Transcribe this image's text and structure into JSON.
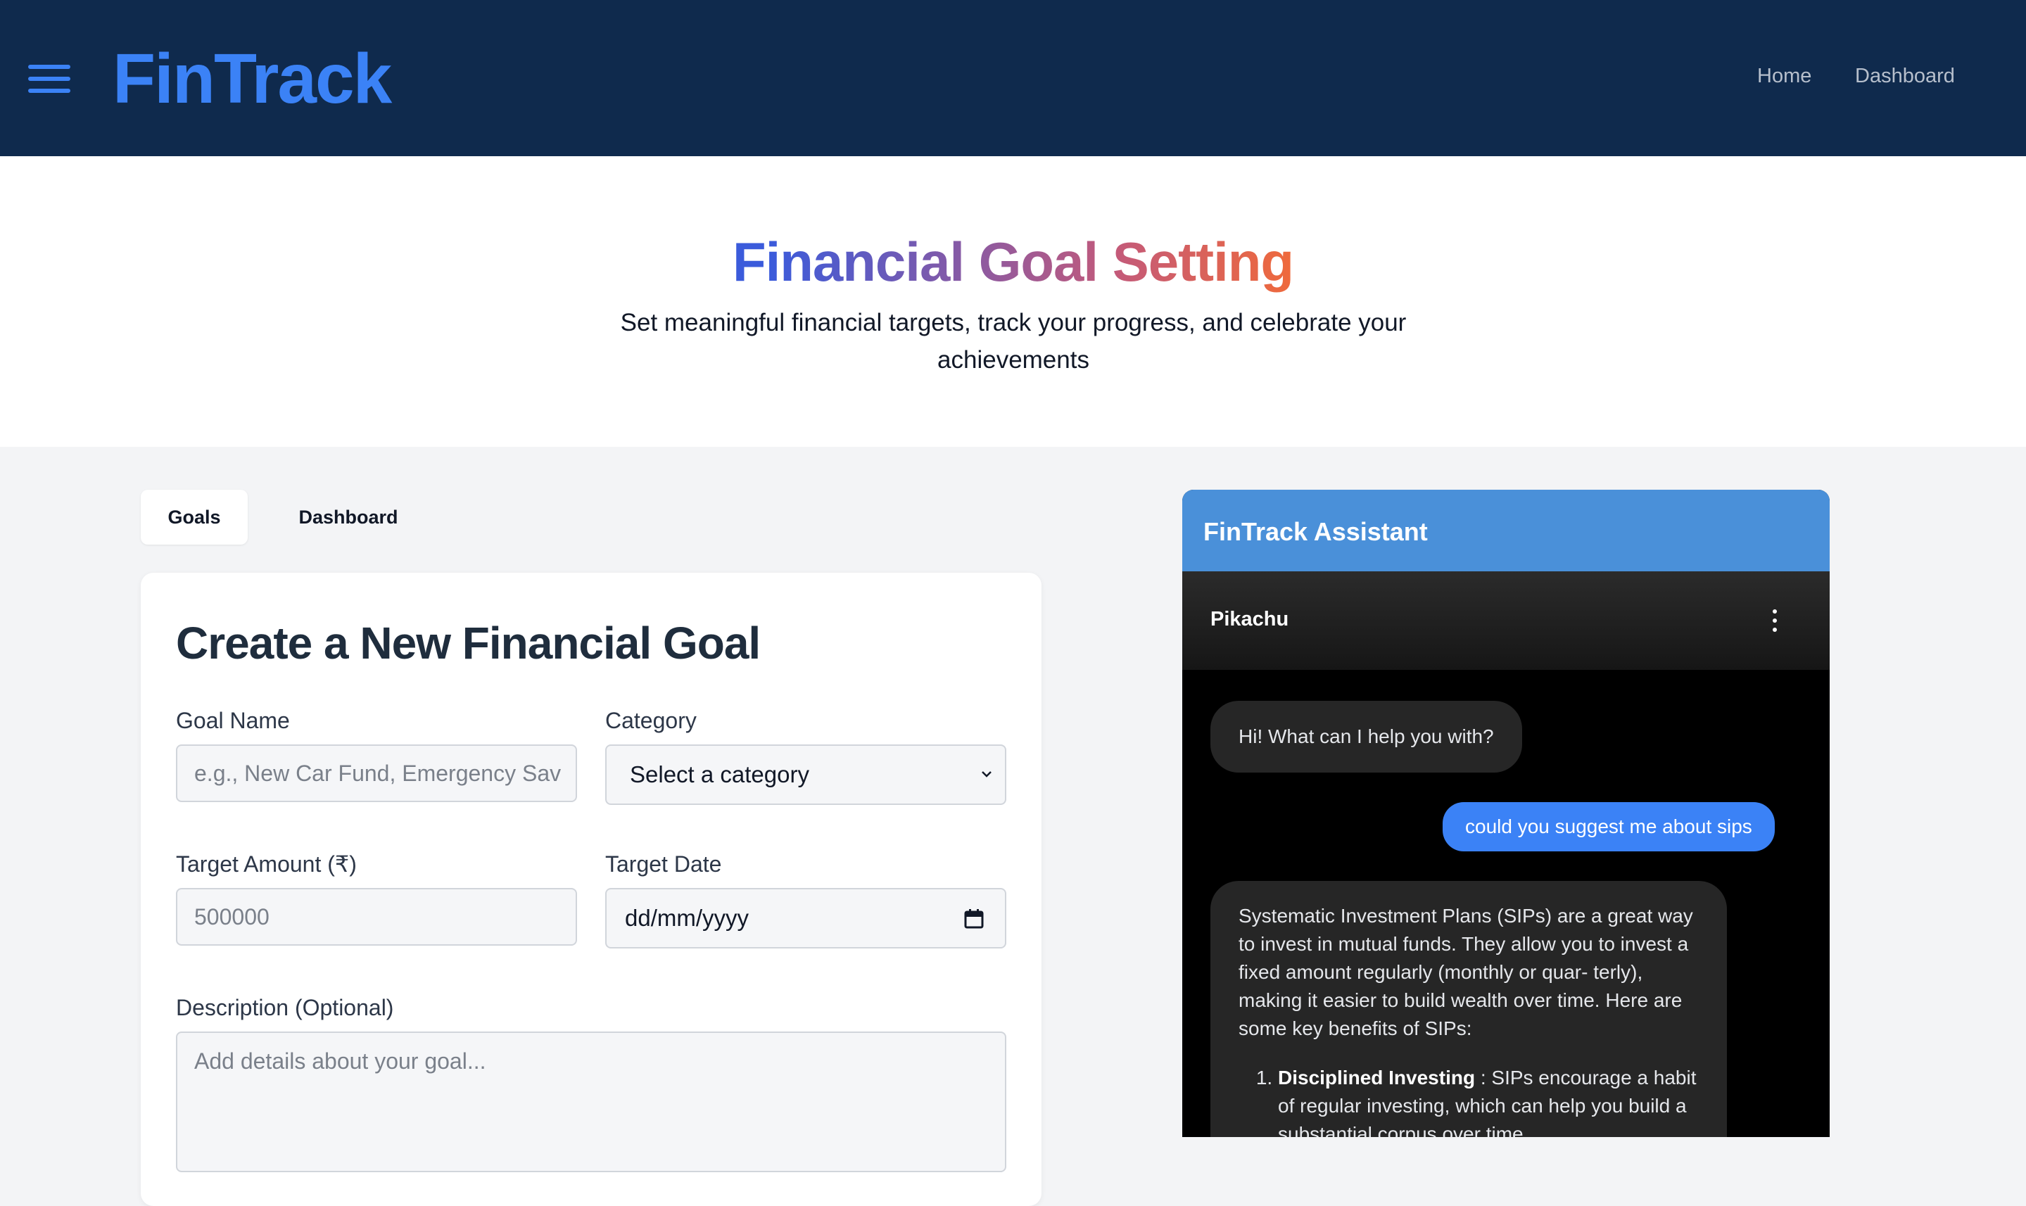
{
  "navbar": {
    "brand": "FinTrack",
    "links": [
      {
        "label": "Home"
      },
      {
        "label": "Dashboard"
      }
    ]
  },
  "hero": {
    "title": "Financial Goal Setting",
    "subtitle": "Set meaningful financial targets, track your progress, and celebrate your achievements"
  },
  "tabs": [
    {
      "label": "Goals",
      "active": true
    },
    {
      "label": "Dashboard",
      "active": false
    }
  ],
  "form": {
    "title": "Create a New Financial Goal",
    "goal_name": {
      "label": "Goal Name",
      "placeholder": "e.g., New Car Fund, Emergency Sav"
    },
    "category": {
      "label": "Category",
      "value": "Select a category"
    },
    "target_amount": {
      "label": "Target Amount (₹)",
      "placeholder": "500000"
    },
    "target_date": {
      "label": "Target Date",
      "value": "dd/mm/yyyy"
    },
    "description": {
      "label": "Description (Optional)",
      "placeholder": "Add details about your goal..."
    }
  },
  "chat": {
    "title": "FinTrack Assistant",
    "bot_name": "Pikachu",
    "messages": [
      {
        "from": "bot",
        "text": "Hi! What can I help you with?"
      },
      {
        "from": "user",
        "text": "could you suggest me about sips"
      },
      {
        "from": "bot",
        "text": "Systematic Investment Plans (SIPs) are a great way to invest in mutual funds. They allow you to invest a fixed amount regularly (monthly or quar- terly), making it easier to build wealth over time. Here are some key benefits of SIPs:",
        "list": [
          {
            "title": "Disciplined Investing",
            "text": " : SIPs encourage a habit of regular investing, which can help you build a substantial corpus over time."
          }
        ]
      }
    ]
  },
  "colors": {
    "navbar_bg": "#0f2a4d",
    "brand": "#3b82f6",
    "chat_header": "#4a90d9",
    "user_bubble": "#3b82f6"
  }
}
